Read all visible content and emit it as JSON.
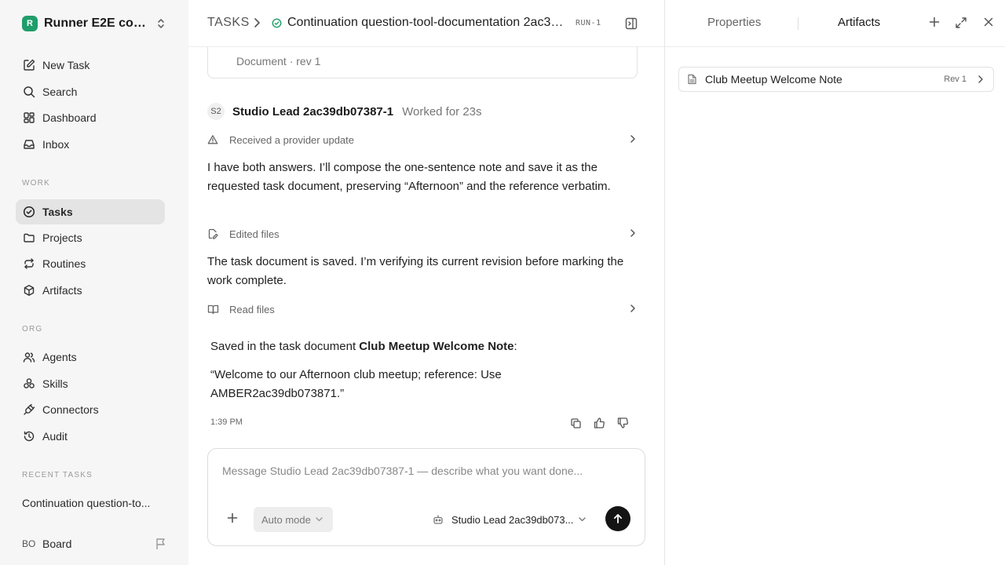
{
  "sidebar": {
    "workspace": {
      "logo": "R",
      "name": "Runner E2E conti..."
    },
    "main_nav": [
      {
        "id": "new-task",
        "label": "New Task",
        "icon": "new-task-icon"
      },
      {
        "id": "search",
        "label": "Search",
        "icon": "search-icon"
      },
      {
        "id": "dashboard",
        "label": "Dashboard",
        "icon": "dashboard-icon"
      },
      {
        "id": "inbox",
        "label": "Inbox",
        "icon": "inbox-icon"
      }
    ],
    "work_label": "WORK",
    "work_nav": [
      {
        "id": "tasks",
        "label": "Tasks",
        "icon": "check-circle-icon",
        "active": true
      },
      {
        "id": "projects",
        "label": "Projects",
        "icon": "folder-icon"
      },
      {
        "id": "routines",
        "label": "Routines",
        "icon": "repeat-icon"
      },
      {
        "id": "artifacts",
        "label": "Artifacts",
        "icon": "box-icon"
      }
    ],
    "org_label": "ORG",
    "org_nav": [
      {
        "id": "agents",
        "label": "Agents",
        "icon": "users-icon"
      },
      {
        "id": "skills",
        "label": "Skills",
        "icon": "skills-icon"
      },
      {
        "id": "connectors",
        "label": "Connectors",
        "icon": "plug-icon"
      },
      {
        "id": "audit",
        "label": "Audit",
        "icon": "history-icon"
      }
    ],
    "recent_label": "RECENT TASKS",
    "recent_tasks": [
      "Continuation question-to..."
    ],
    "user": {
      "initials": "BO",
      "name": "Board"
    }
  },
  "header": {
    "root": "TASKS",
    "title": "Continuation question-tool-documentation 2ac39db...",
    "run_id": "RUN-1"
  },
  "thread": {
    "doc_card_meta": "Document · rev 1",
    "agent": {
      "initials": "S2",
      "name": "Studio Lead 2ac39db07387-1",
      "worked": "Worked for 23s"
    },
    "events": [
      {
        "label": "Received a provider update",
        "icon": "warning-icon"
      },
      {
        "label": "Edited files",
        "icon": "edit-file-icon"
      },
      {
        "label": "Read files",
        "icon": "book-icon"
      }
    ],
    "messages": [
      "I have both answers. I’ll compose the one-sentence note and save it as the requested task document, preserving “Afternoon” and the reference verbatim.",
      "The task document is saved. I’m verifying its current revision before marking the work complete."
    ],
    "final": {
      "prefix": "Saved in the task document ",
      "doc_name": "Club Meetup Welcome Note",
      "suffix": ":",
      "quote": "“Welcome to our Afternoon club meetup; reference: Use AMBER2ac39db073871.”"
    },
    "timestamp": "1:39 PM"
  },
  "composer": {
    "placeholder": "Message Studio Lead 2ac39db07387-1 — describe what you want done...",
    "mode": "Auto mode",
    "agent": "Studio Lead 2ac39db073..."
  },
  "right_panel": {
    "tabs": [
      "Properties",
      "Artifacts"
    ],
    "active_tab": "Artifacts",
    "artifacts": [
      {
        "name": "Club Meetup Welcome Note",
        "rev": "Rev 1"
      }
    ]
  }
}
